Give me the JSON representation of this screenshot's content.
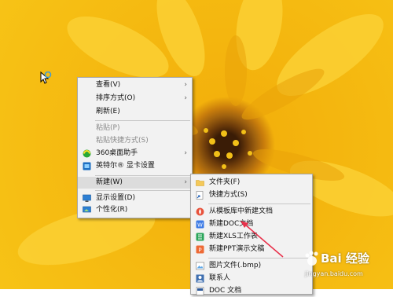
{
  "context_menu": {
    "items": [
      {
        "label": "查看(V)",
        "icon": "",
        "submenu": true
      },
      {
        "label": "排序方式(O)",
        "icon": "",
        "submenu": true
      },
      {
        "label": "刷新(E)",
        "icon": ""
      },
      {
        "label": "粘贴(P)",
        "icon": "",
        "disabled": true
      },
      {
        "label": "粘贴快捷方式(S)",
        "icon": "",
        "disabled": true
      },
      {
        "label": "360桌面助手",
        "icon": "360-icon",
        "submenu": true
      },
      {
        "label": "英特尔® 显卡设置",
        "icon": "intel-graphics-icon"
      },
      {
        "label": "新建(W)",
        "icon": "",
        "submenu": true
      },
      {
        "label": "显示设置(D)",
        "icon": "display-icon"
      },
      {
        "label": "个性化(R)",
        "icon": "personalize-icon"
      }
    ]
  },
  "new_submenu": {
    "items": [
      {
        "label": "文件夹(F)",
        "icon": "folder-icon"
      },
      {
        "label": "快捷方式(S)",
        "icon": "shortcut-icon"
      },
      {
        "label": "从模板库中新建文档",
        "icon": "template-icon"
      },
      {
        "label": "新建DOC文档",
        "icon": "doc-icon"
      },
      {
        "label": "新建XLS工作表",
        "icon": "xls-icon"
      },
      {
        "label": "新建PPT演示文稿",
        "icon": "ppt-icon"
      },
      {
        "label": "图片文件(.bmp)",
        "icon": "bmp-icon"
      },
      {
        "label": "联系人",
        "icon": "contact-icon"
      },
      {
        "label": "DOC 文档",
        "icon": "doc-file-icon"
      }
    ]
  },
  "watermark": {
    "brand": "Bai 经验",
    "url": "jingyan.baidu.com"
  },
  "colors": {
    "menu_bg": "#f2f2f2",
    "accent": "#e8304a",
    "wallpaper": "#f7c316"
  }
}
